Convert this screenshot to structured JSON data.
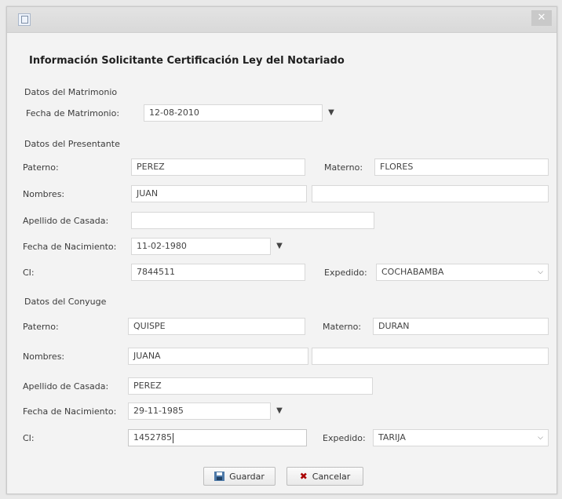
{
  "window": {
    "close_glyph": "✕"
  },
  "form": {
    "title": "Información Solicitante Certificación Ley del Notariado",
    "matrimonio": {
      "section": "Datos del Matrimonio",
      "fecha_label": "Fecha de Matrimonio:",
      "fecha_value": "12-08-2010"
    },
    "presentante": {
      "section": "Datos del Presentante",
      "paterno_label": "Paterno:",
      "paterno_value": "PEREZ",
      "materno_label": "Materno:",
      "materno_value": "FLORES",
      "nombres_label": "Nombres:",
      "nombres_value": "JUAN",
      "nombres2_value": "",
      "apellido_casada_label": "Apellido de Casada:",
      "apellido_casada_value": "",
      "nacimiento_label": "Fecha de Nacimiento:",
      "nacimiento_value": "11-02-1980",
      "ci_label": "CI:",
      "ci_value": "7844511",
      "expedido_label": "Expedido:",
      "expedido_value": "COCHABAMBA"
    },
    "conyuge": {
      "section": "Datos del Conyuge",
      "paterno_label": "Paterno:",
      "paterno_value": "QUISPE",
      "materno_label": "Materno:",
      "materno_value": "DURAN",
      "nombres_label": "Nombres:",
      "nombres_value": "JUANA",
      "nombres2_value": "",
      "apellido_casada_label": "Apellido de Casada:",
      "apellido_casada_value": "PEREZ",
      "nacimiento_label": "Fecha de Nacimiento:",
      "nacimiento_value": "29-11-1985",
      "ci_label": "CI:",
      "ci_value": "1452785",
      "expedido_label": "Expedido:",
      "expedido_value": "TARIJA"
    },
    "buttons": {
      "save_label": "Guardar",
      "cancel_label": "Cancelar"
    }
  }
}
